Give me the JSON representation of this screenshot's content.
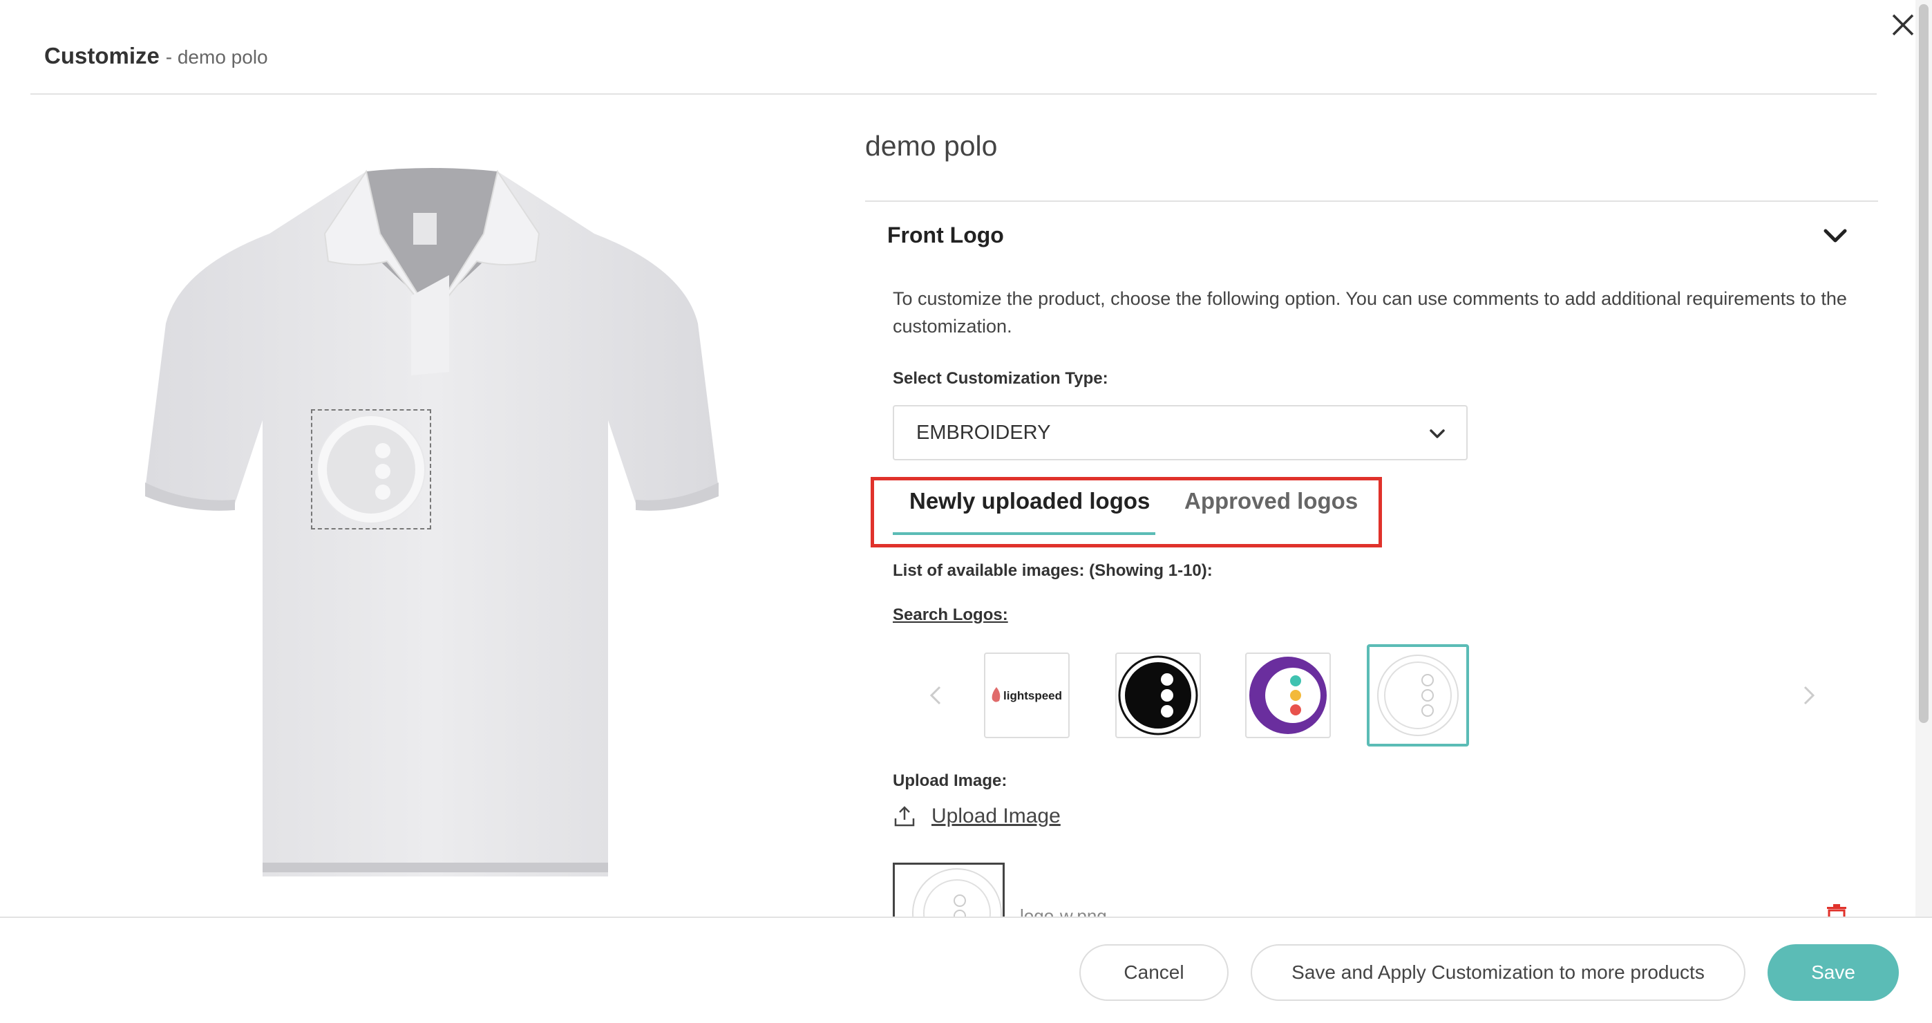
{
  "header": {
    "title": "Customize",
    "subtitle": "- demo polo"
  },
  "product": {
    "name": "demo polo"
  },
  "section": {
    "title": "Front Logo",
    "description": "To customize the product, choose the following option. You can use comments to add additional requirements to the customization."
  },
  "customization": {
    "type_label": "Select Customization Type:",
    "type_value": "EMBROIDERY"
  },
  "tabs": [
    {
      "label": "Newly uploaded logos",
      "active": true
    },
    {
      "label": "Approved logos",
      "active": false
    }
  ],
  "list": {
    "label": "List of available images: (Showing 1-10):",
    "search_label": "Search Logos:",
    "logos": [
      {
        "name": "lightspeed",
        "text": "lightspeed"
      },
      {
        "name": "black-dots-logo"
      },
      {
        "name": "purple-dots-logo"
      },
      {
        "name": "white-dots-logo",
        "selected": true
      }
    ]
  },
  "upload": {
    "label": "Upload Image:",
    "link_text": "Upload Image",
    "filename": "logo-w.png"
  },
  "footer": {
    "cancel": "Cancel",
    "apply": "Save and Apply Customization to more products",
    "save": "Save"
  },
  "colors": {
    "accent": "#5bbcb6",
    "highlight": "#e0322b"
  },
  "icons": [
    "close-icon",
    "chevron-down-icon",
    "chevron-left-icon",
    "chevron-right-icon",
    "upload-icon",
    "trash-icon"
  ]
}
